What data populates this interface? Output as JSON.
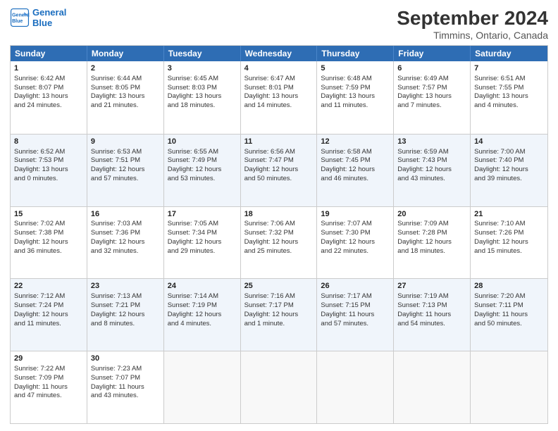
{
  "logo": {
    "line1": "General",
    "line2": "Blue"
  },
  "title": "September 2024",
  "location": "Timmins, Ontario, Canada",
  "header_days": [
    "Sunday",
    "Monday",
    "Tuesday",
    "Wednesday",
    "Thursday",
    "Friday",
    "Saturday"
  ],
  "rows": [
    [
      {
        "day": "1",
        "sunrise": "Sunrise: 6:42 AM",
        "sunset": "Sunset: 8:07 PM",
        "daylight": "Daylight: 13 hours",
        "extra": "and 24 minutes."
      },
      {
        "day": "2",
        "sunrise": "Sunrise: 6:44 AM",
        "sunset": "Sunset: 8:05 PM",
        "daylight": "Daylight: 13 hours",
        "extra": "and 21 minutes."
      },
      {
        "day": "3",
        "sunrise": "Sunrise: 6:45 AM",
        "sunset": "Sunset: 8:03 PM",
        "daylight": "Daylight: 13 hours",
        "extra": "and 18 minutes."
      },
      {
        "day": "4",
        "sunrise": "Sunrise: 6:47 AM",
        "sunset": "Sunset: 8:01 PM",
        "daylight": "Daylight: 13 hours",
        "extra": "and 14 minutes."
      },
      {
        "day": "5",
        "sunrise": "Sunrise: 6:48 AM",
        "sunset": "Sunset: 7:59 PM",
        "daylight": "Daylight: 13 hours",
        "extra": "and 11 minutes."
      },
      {
        "day": "6",
        "sunrise": "Sunrise: 6:49 AM",
        "sunset": "Sunset: 7:57 PM",
        "daylight": "Daylight: 13 hours",
        "extra": "and 7 minutes."
      },
      {
        "day": "7",
        "sunrise": "Sunrise: 6:51 AM",
        "sunset": "Sunset: 7:55 PM",
        "daylight": "Daylight: 13 hours",
        "extra": "and 4 minutes."
      }
    ],
    [
      {
        "day": "8",
        "sunrise": "Sunrise: 6:52 AM",
        "sunset": "Sunset: 7:53 PM",
        "daylight": "Daylight: 13 hours",
        "extra": "and 0 minutes."
      },
      {
        "day": "9",
        "sunrise": "Sunrise: 6:53 AM",
        "sunset": "Sunset: 7:51 PM",
        "daylight": "Daylight: 12 hours",
        "extra": "and 57 minutes."
      },
      {
        "day": "10",
        "sunrise": "Sunrise: 6:55 AM",
        "sunset": "Sunset: 7:49 PM",
        "daylight": "Daylight: 12 hours",
        "extra": "and 53 minutes."
      },
      {
        "day": "11",
        "sunrise": "Sunrise: 6:56 AM",
        "sunset": "Sunset: 7:47 PM",
        "daylight": "Daylight: 12 hours",
        "extra": "and 50 minutes."
      },
      {
        "day": "12",
        "sunrise": "Sunrise: 6:58 AM",
        "sunset": "Sunset: 7:45 PM",
        "daylight": "Daylight: 12 hours",
        "extra": "and 46 minutes."
      },
      {
        "day": "13",
        "sunrise": "Sunrise: 6:59 AM",
        "sunset": "Sunset: 7:43 PM",
        "daylight": "Daylight: 12 hours",
        "extra": "and 43 minutes."
      },
      {
        "day": "14",
        "sunrise": "Sunrise: 7:00 AM",
        "sunset": "Sunset: 7:40 PM",
        "daylight": "Daylight: 12 hours",
        "extra": "and 39 minutes."
      }
    ],
    [
      {
        "day": "15",
        "sunrise": "Sunrise: 7:02 AM",
        "sunset": "Sunset: 7:38 PM",
        "daylight": "Daylight: 12 hours",
        "extra": "and 36 minutes."
      },
      {
        "day": "16",
        "sunrise": "Sunrise: 7:03 AM",
        "sunset": "Sunset: 7:36 PM",
        "daylight": "Daylight: 12 hours",
        "extra": "and 32 minutes."
      },
      {
        "day": "17",
        "sunrise": "Sunrise: 7:05 AM",
        "sunset": "Sunset: 7:34 PM",
        "daylight": "Daylight: 12 hours",
        "extra": "and 29 minutes."
      },
      {
        "day": "18",
        "sunrise": "Sunrise: 7:06 AM",
        "sunset": "Sunset: 7:32 PM",
        "daylight": "Daylight: 12 hours",
        "extra": "and 25 minutes."
      },
      {
        "day": "19",
        "sunrise": "Sunrise: 7:07 AM",
        "sunset": "Sunset: 7:30 PM",
        "daylight": "Daylight: 12 hours",
        "extra": "and 22 minutes."
      },
      {
        "day": "20",
        "sunrise": "Sunrise: 7:09 AM",
        "sunset": "Sunset: 7:28 PM",
        "daylight": "Daylight: 12 hours",
        "extra": "and 18 minutes."
      },
      {
        "day": "21",
        "sunrise": "Sunrise: 7:10 AM",
        "sunset": "Sunset: 7:26 PM",
        "daylight": "Daylight: 12 hours",
        "extra": "and 15 minutes."
      }
    ],
    [
      {
        "day": "22",
        "sunrise": "Sunrise: 7:12 AM",
        "sunset": "Sunset: 7:24 PM",
        "daylight": "Daylight: 12 hours",
        "extra": "and 11 minutes."
      },
      {
        "day": "23",
        "sunrise": "Sunrise: 7:13 AM",
        "sunset": "Sunset: 7:21 PM",
        "daylight": "Daylight: 12 hours",
        "extra": "and 8 minutes."
      },
      {
        "day": "24",
        "sunrise": "Sunrise: 7:14 AM",
        "sunset": "Sunset: 7:19 PM",
        "daylight": "Daylight: 12 hours",
        "extra": "and 4 minutes."
      },
      {
        "day": "25",
        "sunrise": "Sunrise: 7:16 AM",
        "sunset": "Sunset: 7:17 PM",
        "daylight": "Daylight: 12 hours",
        "extra": "and 1 minute."
      },
      {
        "day": "26",
        "sunrise": "Sunrise: 7:17 AM",
        "sunset": "Sunset: 7:15 PM",
        "daylight": "Daylight: 11 hours",
        "extra": "and 57 minutes."
      },
      {
        "day": "27",
        "sunrise": "Sunrise: 7:19 AM",
        "sunset": "Sunset: 7:13 PM",
        "daylight": "Daylight: 11 hours",
        "extra": "and 54 minutes."
      },
      {
        "day": "28",
        "sunrise": "Sunrise: 7:20 AM",
        "sunset": "Sunset: 7:11 PM",
        "daylight": "Daylight: 11 hours",
        "extra": "and 50 minutes."
      }
    ],
    [
      {
        "day": "29",
        "sunrise": "Sunrise: 7:22 AM",
        "sunset": "Sunset: 7:09 PM",
        "daylight": "Daylight: 11 hours",
        "extra": "and 47 minutes."
      },
      {
        "day": "30",
        "sunrise": "Sunrise: 7:23 AM",
        "sunset": "Sunset: 7:07 PM",
        "daylight": "Daylight: 11 hours",
        "extra": "and 43 minutes."
      },
      null,
      null,
      null,
      null,
      null
    ]
  ]
}
